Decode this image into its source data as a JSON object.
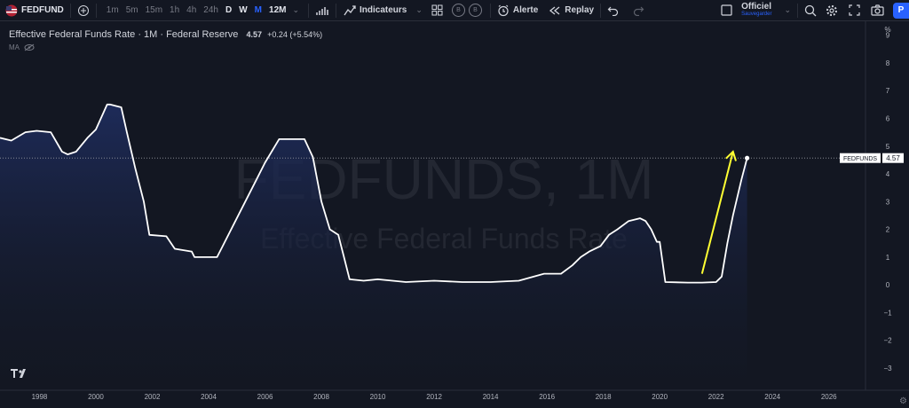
{
  "toolbar": {
    "symbol": "FEDFUND",
    "intervals": [
      "1m",
      "5m",
      "15m",
      "1h",
      "4h",
      "24h",
      "D",
      "W",
      "M",
      "12M"
    ],
    "indicators_label": "Indicateurs",
    "circle_a": "B",
    "circle_b": "B",
    "alert_label": "Alerte",
    "replay_label": "Replay",
    "layout_name": "Officiel",
    "layout_status": "Sauvegarder",
    "publish_label": "P"
  },
  "legend": {
    "title": "Effective Federal Funds Rate · 1M · Federal Reserve",
    "last": "4.57",
    "change": "+0.24 (+5.54%)",
    "ma_label": "MA"
  },
  "watermark": {
    "line1": "FEDFUNDS, 1M",
    "line2": "Effective Federal Funds Rate"
  },
  "price_label": {
    "name": "FEDFUNDS",
    "value": "4.57"
  },
  "colors": {
    "background": "#131722",
    "line": "#ffffff",
    "area_top": "#1e2c5c",
    "arrow": "#ffff33",
    "text": "#d1d4dc"
  },
  "chart_data": {
    "type": "area",
    "x_ticks": [
      "1998",
      "2000",
      "2002",
      "2004",
      "2006",
      "2008",
      "2010",
      "2012",
      "2014",
      "2016",
      "2018",
      "2020",
      "2022",
      "2024",
      "2026"
    ],
    "y_ticks": [
      "%",
      "9",
      "8",
      "7",
      "6",
      "5",
      "4",
      "3",
      "2",
      "1",
      "0",
      "−1",
      "−2",
      "−3"
    ],
    "xlim": [
      1996.6,
      2027.3
    ],
    "ylim": [
      -3.8,
      9.5
    ],
    "series": [
      {
        "x": [
          1996.6,
          1997.0,
          1997.5,
          1997.9,
          1998.4,
          1998.8,
          1999.0,
          1999.3,
          1999.7,
          2000.0,
          2000.4,
          2000.5,
          2000.9,
          2001.1,
          2001.4,
          2001.7,
          2001.9,
          2002.5,
          2002.8,
          2003.4,
          2003.5,
          2004.3,
          2004.5,
          2004.9,
          2005.3,
          2005.7,
          2006.0,
          2006.5,
          2007.4,
          2007.7,
          2008.0,
          2008.3,
          2008.6,
          2008.8,
          2009.0,
          2009.5,
          2010.0,
          2011.0,
          2012.0,
          2013.0,
          2014.0,
          2015.0,
          2015.9,
          2016.5,
          2016.9,
          2017.2,
          2017.5,
          2017.9,
          2018.2,
          2018.5,
          2018.9,
          2019.3,
          2019.5,
          2019.7,
          2019.9,
          2020.0,
          2020.2,
          2021.0,
          2021.5,
          2022.0,
          2022.2,
          2022.4,
          2022.6,
          2022.9,
          2023.1
        ],
        "y": [
          5.3,
          5.2,
          5.5,
          5.55,
          5.5,
          4.8,
          4.7,
          4.8,
          5.3,
          5.6,
          6.5,
          6.5,
          6.4,
          5.5,
          4.2,
          3.0,
          1.8,
          1.75,
          1.3,
          1.2,
          1.0,
          1.0,
          1.4,
          2.2,
          3.0,
          3.8,
          4.4,
          5.25,
          5.25,
          4.6,
          3.0,
          2.0,
          1.8,
          1.0,
          0.2,
          0.15,
          0.2,
          0.1,
          0.15,
          0.1,
          0.1,
          0.15,
          0.4,
          0.4,
          0.7,
          1.0,
          1.2,
          1.4,
          1.8,
          2.0,
          2.3,
          2.4,
          2.3,
          2.0,
          1.55,
          1.55,
          0.1,
          0.08,
          0.08,
          0.1,
          0.3,
          1.5,
          2.5,
          3.8,
          4.57
        ],
        "color": "#ffffff"
      }
    ],
    "annotation": {
      "type": "arrow",
      "from": [
        2021.5,
        0.4
      ],
      "to": [
        2022.6,
        4.8
      ],
      "color": "#ffff33"
    },
    "grid": false,
    "legend": "top-left"
  }
}
